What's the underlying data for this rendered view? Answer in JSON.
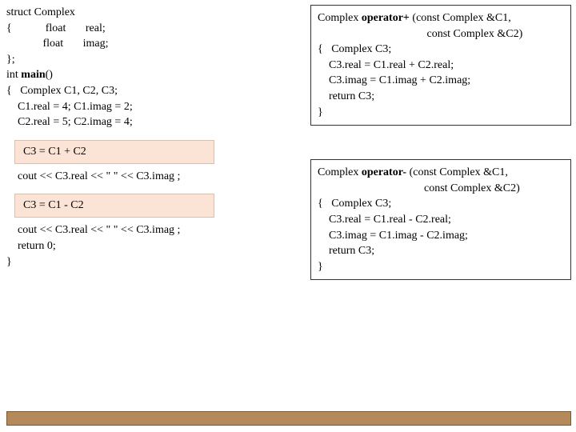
{
  "left": {
    "l1": "struct Complex",
    "l2": "{            float       real;",
    "l3": "             float       imag;",
    "l4": "};",
    "l5": "",
    "l6a": "int ",
    "l6b": "main",
    "l6c": "()",
    "l7": "{   Complex C1, C2, C3;",
    "l8": "",
    "l9": "    C1.real = 4; C1.imag = 2;",
    "l10": "    C2.real = 5; C2.imag = 4;",
    "h1": "C3 = C1 + C2",
    "l11": "    cout << C3.real << \" \" << C3.imag ;",
    "h2": "C3 = C1 - C2",
    "l12": "    cout << C3.real << \" \" << C3.imag ;",
    "l13": "    return 0;",
    "l14": "}"
  },
  "plus": {
    "l1a": "Complex ",
    "l1b": "operator+ ",
    "l1c": "(const Complex &C1,",
    "l2": "                                       const Complex &C2)",
    "l3": "{   Complex C3;",
    "l4": "    C3.real = C1.real + C2.real;",
    "l5": "    C3.imag = C1.imag + C2.imag;",
    "l6": "    return C3;",
    "l7": "}"
  },
  "minus": {
    "l1a": "Complex ",
    "l1b": "operator- ",
    "l1c": "(const Complex &C1,",
    "l2": "                                      const Complex &C2)",
    "l3": "{   Complex C3;",
    "l4": "    C3.real = C1.real - C2.real;",
    "l5": "    C3.imag = C1.imag - C2.imag;",
    "l6": "    return C3;",
    "l7": "}"
  }
}
